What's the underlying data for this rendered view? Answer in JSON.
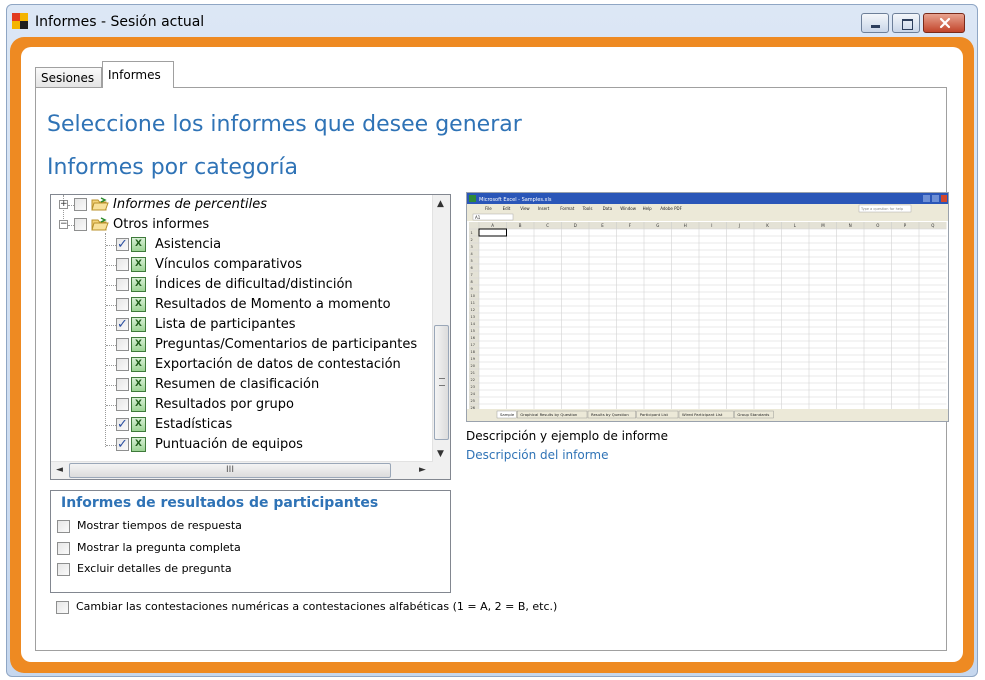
{
  "window": {
    "title": "Informes - Sesión actual"
  },
  "tabs": [
    {
      "label": "Sesiones",
      "active": false
    },
    {
      "label": "Informes",
      "active": true
    }
  ],
  "headings": {
    "main": "Seleccione los informes que desee generar",
    "sub": "Informes por categoría"
  },
  "tree": {
    "categories": [
      {
        "label": "Informes de percentiles",
        "expanded": false,
        "checked": false
      },
      {
        "label": "Otros informes",
        "expanded": true,
        "checked": false
      }
    ],
    "items": [
      {
        "label": "Asistencia",
        "checked": true
      },
      {
        "label": "Vínculos comparativos",
        "checked": false
      },
      {
        "label": "Índices de dificultad/distinción",
        "checked": false
      },
      {
        "label": "Resultados de Momento a momento",
        "checked": false
      },
      {
        "label": "Lista de participantes",
        "checked": true
      },
      {
        "label": "Preguntas/Comentarios de participantes",
        "checked": false
      },
      {
        "label": "Exportación de datos de contestación",
        "checked": false
      },
      {
        "label": "Resumen de clasificación",
        "checked": false
      },
      {
        "label": "Resultados por grupo",
        "checked": false
      },
      {
        "label": "Estadísticas",
        "checked": true
      },
      {
        "label": "Puntuación de equipos",
        "checked": true
      }
    ],
    "hscroll_grip": "III"
  },
  "participant_options": {
    "title": "Informes de resultados de participantes",
    "options": [
      {
        "label": "Mostrar tiempos de respuesta",
        "checked": false
      },
      {
        "label": "Mostrar la pregunta completa",
        "checked": false
      },
      {
        "label": "Excluir detalles de pregunta",
        "checked": false
      }
    ]
  },
  "alpha_option": {
    "label": "Cambiar las contestaciones numéricas a contestaciones alfabéticas (1 = A, 2 = B, etc.)",
    "checked": false
  },
  "preview": {
    "caption": "Descripción y ejemplo de informe",
    "link": "Descripción del informe",
    "excel": {
      "title": "Microsoft Excel - Samples.xls",
      "menu": [
        "File",
        "Edit",
        "View",
        "Insert",
        "Format",
        "Tools",
        "Data",
        "Window",
        "Help",
        "Adobe PDF"
      ],
      "help_box": "Type a question for help",
      "cell_ref": "A1",
      "columns": [
        "A",
        "B",
        "C",
        "D",
        "E",
        "F",
        "G",
        "H",
        "I",
        "J",
        "K",
        "L",
        "M",
        "N",
        "O",
        "P",
        "Q"
      ],
      "rows": [
        "1",
        "2",
        "3",
        "4",
        "5",
        "6",
        "7",
        "8",
        "9",
        "10",
        "11",
        "12",
        "13",
        "14",
        "15",
        "16",
        "17",
        "18",
        "19",
        "20",
        "21",
        "22",
        "23",
        "24",
        "25",
        "26"
      ],
      "sheets": [
        "Sample",
        "Graphical Results by Question",
        "Results by Question",
        "Participant List",
        "Wired Participant List",
        "Group Standards"
      ]
    }
  },
  "colors": {
    "accent": "#2f73b6",
    "frame": "#ee8a22",
    "checkmark": "#2b4fa1"
  }
}
